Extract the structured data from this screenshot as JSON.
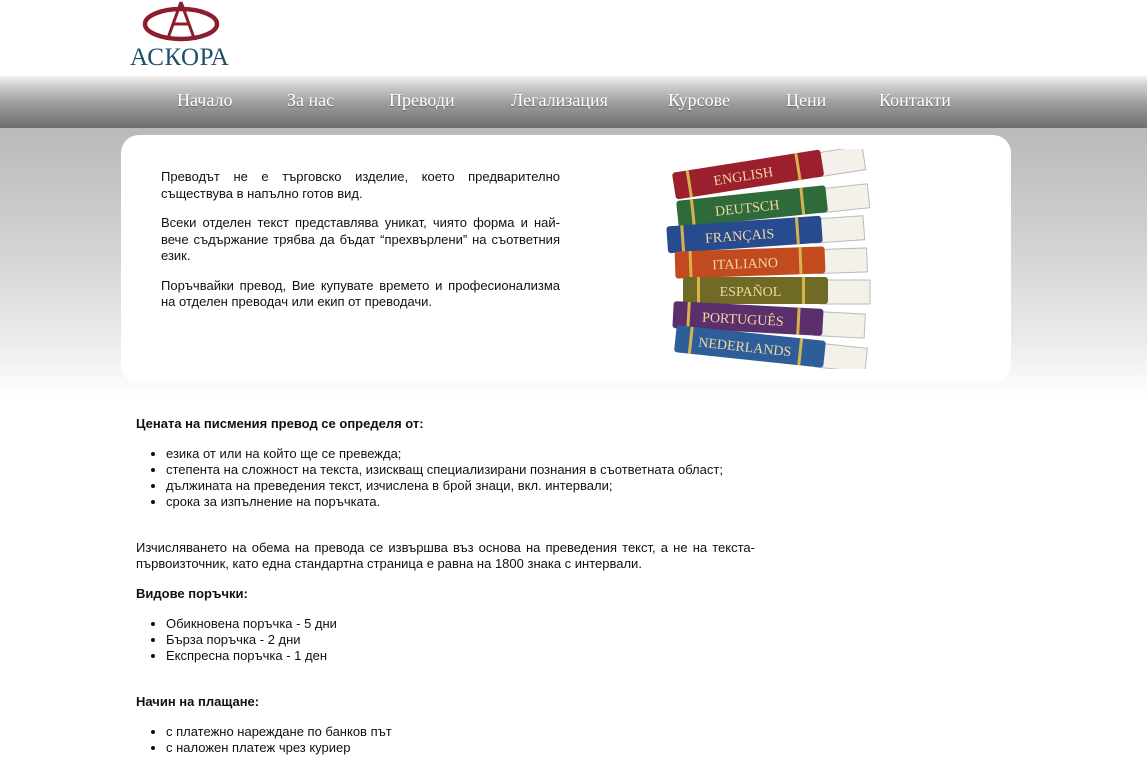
{
  "brand": {
    "name": "АСКОРА"
  },
  "nav": {
    "items": [
      "Начало",
      "За нас",
      "Преводи",
      "Легализация",
      "Курсове",
      "Цени",
      "Контакти"
    ]
  },
  "intro": {
    "p1": "Преводът не е търговско изделие, което предварително съществува в напълно готов вид.",
    "p2": "Всеки отделен текст представлява уникат, чиято форма и най-вече съдържание трябва да бъдат “прехвърлени” на съответния език.",
    "p3": "Поръчвайки превод, Вие купувате времето и професионализма на отделен преводач или екип от преводачи."
  },
  "books": {
    "labels": [
      "ENGLISH",
      "DEUTSCH",
      "FRANÇAIS",
      "ITALIANO",
      "ESPAÑOL",
      "PORTUGUÊS",
      "NEDERLANDS"
    ],
    "colors": [
      "#9c1f2e",
      "#2f6b3a",
      "#284a8f",
      "#c24a1f",
      "#6f6a25",
      "#5a2f6b",
      "#2d5e9a"
    ]
  },
  "pricing": {
    "heading": "Цената на писмения превод се определя от:",
    "factors": [
      "езика от или на който ще се превежда;",
      "степента на сложност на текста, изискващ специализирани познания в съответната област;",
      "дължината на преведения текст, изчислена в брой знаци, вкл. интервали;",
      "срока за изпълнение на поръчката."
    ],
    "volume_text": "Изчисляването на обема на превода се извършва въз основа на преведения текст, а не на текста-първоизточник, като една стандартна страница е равна на 1800 знака с интервали."
  },
  "orders": {
    "heading": "Видове поръчки:",
    "items": [
      "Обикновена поръчка - 5 дни",
      "Бърза поръчка - 2 дни",
      "Експресна поръчка - 1 ден"
    ]
  },
  "payment": {
    "heading": "Начин на плащане:",
    "items": [
      "с платежно нареждане по банков път",
      "с наложен платеж чрез куриер"
    ]
  }
}
